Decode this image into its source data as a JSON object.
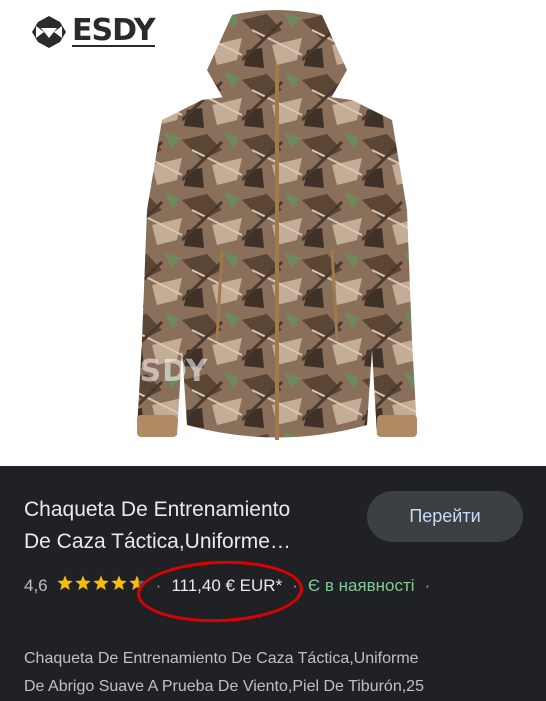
{
  "brand": {
    "logo_text": "ESDY",
    "watermark_text": "ESDY"
  },
  "product": {
    "title_line1": "Chaqueta De Entrenamiento",
    "title_line2": "De Caza Táctica,Uniforme…",
    "rating": "4,6",
    "stars_value": 4.6,
    "stars_max": 5,
    "price": "111,40 € EUR*",
    "availability": "Є в наявності",
    "description_line1": "Chaqueta De Entrenamiento De Caza Táctica,Uniforme",
    "description_line2": "De Abrigo Suave A Prueba De Viento,Piel De Tiburón,25"
  },
  "actions": {
    "go_label": "Перейти"
  },
  "colors": {
    "panel_bg": "#202124",
    "button_bg": "#3c4043",
    "button_text": "#c6dafc",
    "star": "#fbbc04",
    "in_stock": "#81c995",
    "annotation": "#e00000"
  },
  "icons": {
    "logo": "esdy-logo-icon",
    "stars": "star-rating-icon"
  }
}
